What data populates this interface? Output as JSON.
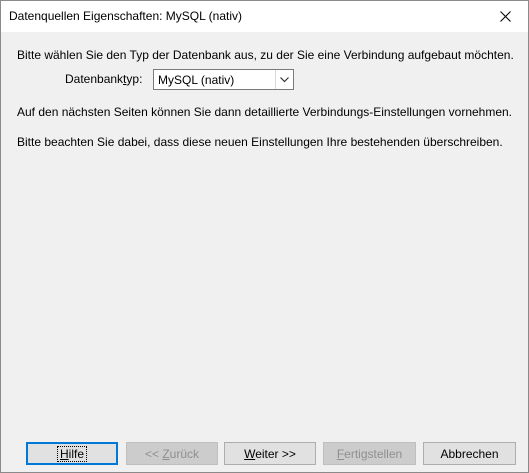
{
  "window": {
    "title": "Datenquellen Eigenschaften: MySQL (nativ)"
  },
  "intro_text": "Bitte wählen Sie den Typ der Datenbank aus, zu der Sie eine Verbindung aufgebaut möchten.",
  "db_type": {
    "label_pre": "Datenbank",
    "label_mnemonic": "t",
    "label_post": "yp:",
    "selected": "MySQL (nativ)"
  },
  "info_text_1": "Auf den nächsten Seiten können Sie dann detaillierte Verbindungs-Einstellungen vornehmen.",
  "info_text_2": "Bitte beachten Sie dabei, dass diese neuen Einstellungen Ihre bestehenden überschreiben.",
  "buttons": {
    "help": {
      "mnemonic": "H",
      "rest": "ilfe"
    },
    "back": {
      "pre": "<< ",
      "mnemonic": "Z",
      "rest": "urück"
    },
    "next": {
      "mnemonic": "W",
      "rest": "eiter >>"
    },
    "finish": {
      "mnemonic": "F",
      "rest": "ertigstellen"
    },
    "cancel": {
      "label": "Abbrechen"
    }
  },
  "icons": {
    "close": "close-icon",
    "dropdown": "chevron-down-icon"
  }
}
